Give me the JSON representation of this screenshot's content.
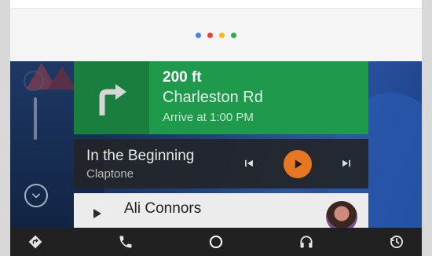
{
  "assistant": {
    "dots": [
      "#4285F4",
      "#EA4335",
      "#FBBC05",
      "#34A853"
    ]
  },
  "navigation": {
    "distance": "200 ft",
    "street": "Charleston Rd",
    "arrival": "Arrive at 1:00 PM",
    "turn_icon": "turn-right-icon",
    "color": "#1F9A4D"
  },
  "media": {
    "title": "In the Beginning",
    "artist": "Claptone",
    "accent": "#E87722"
  },
  "contact": {
    "name": "Ali Connors"
  },
  "bottom_nav": [
    {
      "icon": "directions-icon"
    },
    {
      "icon": "phone-icon"
    },
    {
      "icon": "home-circle-icon"
    },
    {
      "icon": "headphones-icon"
    },
    {
      "icon": "recent-icon"
    }
  ]
}
